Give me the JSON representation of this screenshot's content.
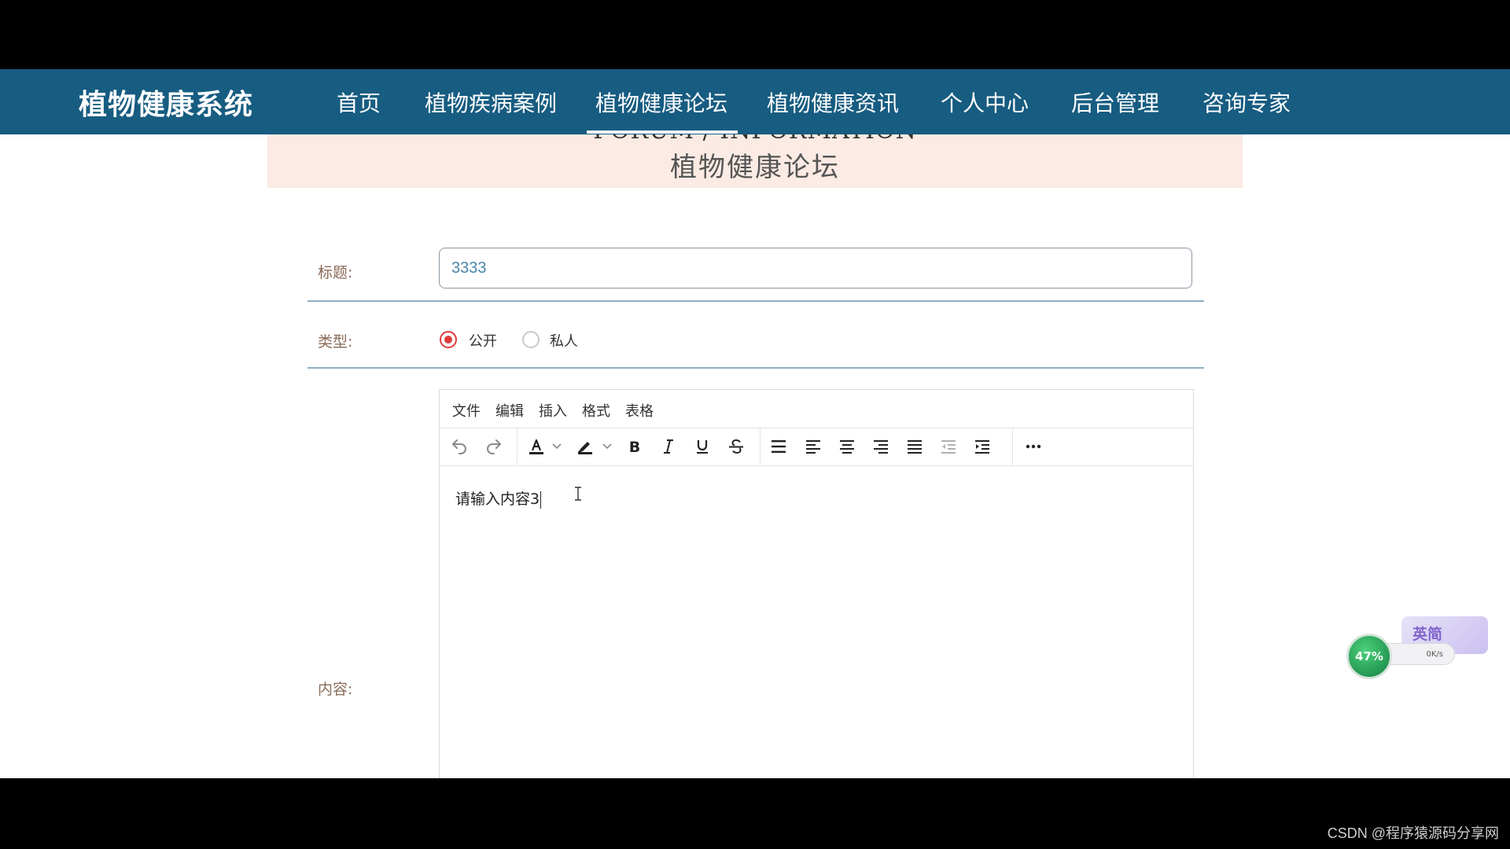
{
  "nav": {
    "brand": "植物健康系统",
    "items": [
      "首页",
      "植物疾病案例",
      "植物健康论坛",
      "植物健康资讯",
      "个人中心",
      "后台管理",
      "咨询专家"
    ],
    "active_index": 2
  },
  "banner": {
    "english": "FORUM / INFORMATION",
    "title": "植物健康论坛"
  },
  "form": {
    "title_label": "标题:",
    "title_value": "3333",
    "type_label": "类型:",
    "type_options": [
      "公开",
      "私人"
    ],
    "type_selected": "公开",
    "content_label": "内容:"
  },
  "editor": {
    "menu": [
      "文件",
      "编辑",
      "插入",
      "格式",
      "表格"
    ],
    "content": "请输入内容3"
  },
  "widget": {
    "percent": "47%",
    "speed": "0K/s",
    "ime": "英简"
  },
  "watermark": "CSDN @程序猿源码分享网",
  "colors": {
    "navbar": "#175c81",
    "banner": "#fbebe4",
    "label": "#8a6a58",
    "radio_active": "#e03a3a"
  }
}
